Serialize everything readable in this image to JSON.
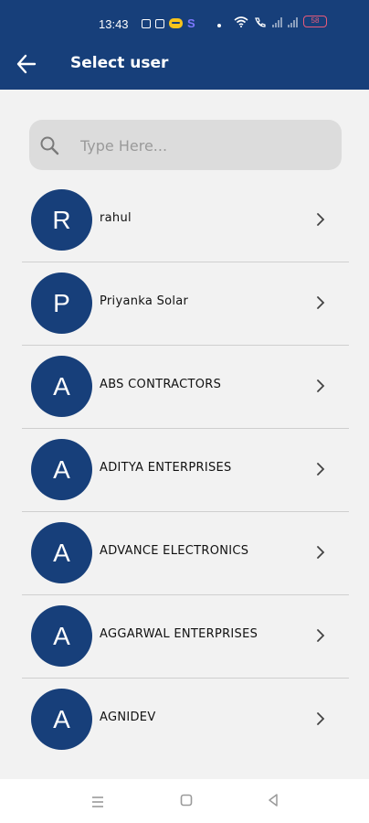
{
  "status_bar": {
    "time": "13:43",
    "s_badge": "S",
    "battery": "58"
  },
  "header": {
    "title": "Select user",
    "back_icon": "arrow-left-icon"
  },
  "search": {
    "placeholder": "Type Here...",
    "value": "",
    "icon": "search-icon"
  },
  "users": [
    {
      "initial": "R",
      "name": "rahul"
    },
    {
      "initial": "P",
      "name": "Priyanka Solar"
    },
    {
      "initial": "A",
      "name": "ABS CONTRACTORS"
    },
    {
      "initial": "A",
      "name": "ADITYA ENTERPRISES"
    },
    {
      "initial": "A",
      "name": "ADVANCE ELECTRONICS"
    },
    {
      "initial": "A",
      "name": "AGGARWAL ENTERPRISES"
    },
    {
      "initial": "A",
      "name": "AGNIDEV"
    }
  ],
  "colors": {
    "primary": "#173f7a",
    "background": "#f2f2f2",
    "search_bg": "#dcdcdc"
  }
}
